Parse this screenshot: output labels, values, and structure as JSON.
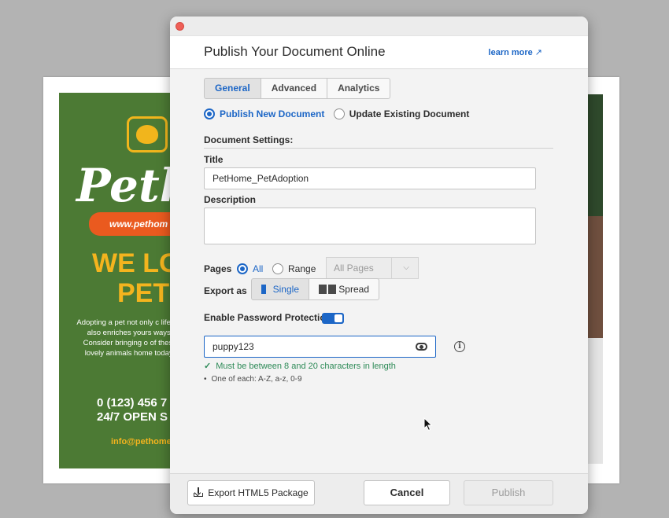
{
  "dialog": {
    "title": "Publish Your Document Online",
    "learn_more": "learn more",
    "learn_more_icon": "external-link-icon"
  },
  "tabs": [
    {
      "label": "General",
      "active": true
    },
    {
      "label": "Advanced",
      "active": false
    },
    {
      "label": "Analytics",
      "active": false
    }
  ],
  "publish_mode": {
    "new_label": "Publish New Document",
    "update_label": "Update Existing Document",
    "selected": "new"
  },
  "settings": {
    "section_title": "Document Settings:",
    "title_label": "Title",
    "title_value": "PetHome_PetAdoption",
    "description_label": "Description",
    "description_value": ""
  },
  "pages": {
    "label": "Pages",
    "all_label": "All",
    "range_label": "Range",
    "selected": "all",
    "range_select_value": "All Pages"
  },
  "export_as": {
    "label": "Export as",
    "single_label": "Single",
    "spread_label": "Spread",
    "selected": "single"
  },
  "password": {
    "label": "Enable Password Protection",
    "enabled": true,
    "value": "puppy123",
    "hint_ok": "Must be between 8 and 20 characters in length",
    "hint_rule": "One of each: A-Z, a-z, 0-9"
  },
  "footer": {
    "export_label": "Export HTML5 Package",
    "cancel_label": "Cancel",
    "publish_label": "Publish"
  },
  "background_flyer": {
    "logo_text": "Petho",
    "url_text": "www.pethom",
    "headline_1": "WE LO",
    "headline_2": "PETS",
    "body": "Adopting a pet not only c life but also enriches yours ways. Consider bringing o of these lovely animals home today!",
    "phone": "0 (123) 456 7",
    "hours": "24/7 OPEN S",
    "email": "info@pethome"
  },
  "colors": {
    "accent": "#1c66c6",
    "success": "#2d8a57",
    "flyer_green": "#4c7a34",
    "flyer_yellow": "#f4b41e",
    "flyer_orange": "#ea5a1f"
  }
}
